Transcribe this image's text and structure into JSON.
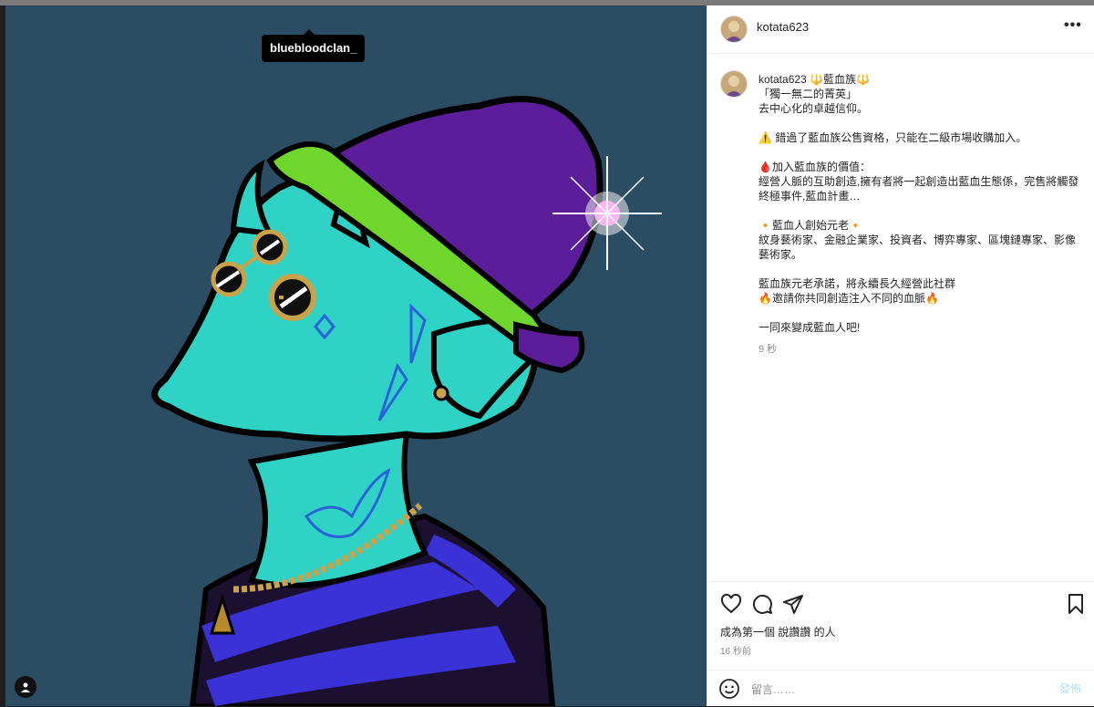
{
  "post": {
    "author": "kotata623",
    "image_tag": "bluebloodclan_",
    "caption_user": "kotata623",
    "caption_text": "🔱藍血族🔱\n「獨一無二的菁英」\n去中心化的卓越信仰。\n\n⚠️ 錯過了藍血族公售資格，只能在二級市場收購加入。\n\n🩸加入藍血族的價值：\n經營人脈的互助創造,擁有者將一起創造出藍血生態係，完售將觸發終極事件,藍血計畫…\n\n🔸藍血人創始元老🔸\n紋身藝術家、金融企業家、投資者、博弈專家、區塊鏈專家、影像藝術家。\n\n藍血族元老承諾，將永續長久經營此社群\n🔥邀請你共同創造注入不同的血脈🔥\n\n一同來變成藍血人吧!",
    "caption_age": "9 秒",
    "likes_text": "成為第一個 說讚讚 的人",
    "post_time": "16 秒前"
  },
  "compose": {
    "placeholder": "留言……",
    "post_label": "發佈"
  },
  "icons": [
    "user-tag-icon",
    "more-icon",
    "heart-icon",
    "comment-icon",
    "share-icon",
    "bookmark-icon",
    "emoji-icon"
  ],
  "colors": {
    "image_bg": "#2a4d63",
    "character_skin": "#2fd3c6",
    "hat": "#5b1d9a",
    "hat_band": "#6fd62c",
    "post_button": "#b2dffc"
  }
}
